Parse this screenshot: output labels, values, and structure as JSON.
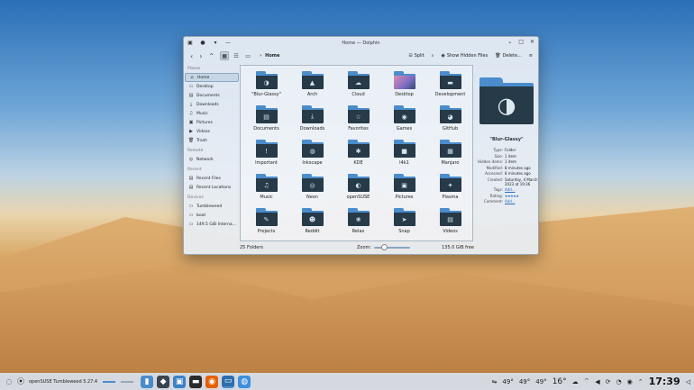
{
  "window": {
    "title": "Home — Dolphin",
    "breadcrumb": "Home"
  },
  "toolbar": {
    "split": "Split",
    "hidden": "Show Hidden Files",
    "delete": "Delete..."
  },
  "sidebar": {
    "places_h": "Places",
    "remote_h": "Remote",
    "recent_h": "Recent",
    "devices_h": "Devices",
    "places": [
      {
        "label": "Home",
        "icon": "home-icon",
        "glyph": "⌂"
      },
      {
        "label": "Desktop",
        "icon": "desktop-icon",
        "glyph": "▭"
      },
      {
        "label": "Documents",
        "icon": "documents-icon",
        "glyph": "▤"
      },
      {
        "label": "Downloads",
        "icon": "downloads-icon",
        "glyph": "⤓"
      },
      {
        "label": "Music",
        "icon": "music-icon",
        "glyph": "♫"
      },
      {
        "label": "Pictures",
        "icon": "pictures-icon",
        "glyph": "▣"
      },
      {
        "label": "Videos",
        "icon": "videos-icon",
        "glyph": "▶"
      },
      {
        "label": "Trash",
        "icon": "trash-icon",
        "glyph": "🗑"
      }
    ],
    "remote": [
      {
        "label": "Network",
        "icon": "network-icon",
        "glyph": "◎"
      }
    ],
    "recent": [
      {
        "label": "Recent Files",
        "icon": "recent-files-icon",
        "glyph": "▤"
      },
      {
        "label": "Recent Locations",
        "icon": "recent-locations-icon",
        "glyph": "▤"
      }
    ],
    "devices": [
      {
        "label": "Tumbleweed",
        "icon": "drive-icon",
        "glyph": "▭"
      },
      {
        "label": "boot",
        "icon": "drive-icon",
        "glyph": "▭"
      },
      {
        "label": "149.5 GiB Interna...",
        "icon": "drive-icon",
        "glyph": "▭"
      }
    ]
  },
  "folders": [
    {
      "label": "\"Blur-Glassy\"",
      "glyph": "◑"
    },
    {
      "label": "Arch",
      "glyph": "▲"
    },
    {
      "label": "Cloud",
      "glyph": "☁"
    },
    {
      "label": "Desktop",
      "glyph": "",
      "style": "img"
    },
    {
      "label": "Development",
      "glyph": "▬"
    },
    {
      "label": "Documents",
      "glyph": "▤"
    },
    {
      "label": "Downloads",
      "glyph": "⤓"
    },
    {
      "label": "Favorites",
      "glyph": "☆"
    },
    {
      "label": "Games",
      "glyph": "◉"
    },
    {
      "label": "GitHub",
      "glyph": "◕"
    },
    {
      "label": "Important",
      "glyph": "!"
    },
    {
      "label": "Inkscape",
      "glyph": "◍"
    },
    {
      "label": "KDE",
      "glyph": "✱"
    },
    {
      "label": "l4k1",
      "glyph": "■"
    },
    {
      "label": "Manjaro",
      "glyph": "▦"
    },
    {
      "label": "Music",
      "glyph": "♫"
    },
    {
      "label": "Neon",
      "glyph": "◎"
    },
    {
      "label": "openSUSE",
      "glyph": "◐"
    },
    {
      "label": "Pictures",
      "glyph": "▣"
    },
    {
      "label": "Plasma",
      "glyph": "✦"
    },
    {
      "label": "Projects",
      "glyph": "✎"
    },
    {
      "label": "Reddit",
      "glyph": "☻"
    },
    {
      "label": "Relax",
      "glyph": "❀"
    },
    {
      "label": "Snap",
      "glyph": "➤"
    },
    {
      "label": "Videos",
      "glyph": "▤"
    }
  ],
  "status": {
    "count": "25 Folders",
    "zoom_label": "Zoom:",
    "free": "135.0 GiB free",
    "zoom_level": 0.2
  },
  "info": {
    "name": "\"Blur-Glassy\"",
    "rows": [
      {
        "k": "Type:",
        "v": "Folder"
      },
      {
        "k": "Size:",
        "v": "1 item"
      },
      {
        "k": "Hidden items:",
        "v": "1 item"
      },
      {
        "k": "Modified:",
        "v": "8 minutes ago"
      },
      {
        "k": "Accessed:",
        "v": "8 minutes ago"
      },
      {
        "k": "Created:",
        "v": "Saturday, 4 March 2023 at 19:36"
      }
    ],
    "tags_k": "Tags:",
    "tags_v": "Add...",
    "rating_k": "Rating:",
    "rating_v": "★★★★★",
    "comment_k": "Comment:",
    "comment_v": "Add..."
  },
  "panel": {
    "distro": "openSUSE Tumbleweed 5.27.4",
    "temps": [
      "49°",
      "49°",
      "49°",
      "16°"
    ],
    "clock": "17:39"
  },
  "colors": {
    "accent": "#4a8ccc",
    "folder": "#263a48"
  }
}
